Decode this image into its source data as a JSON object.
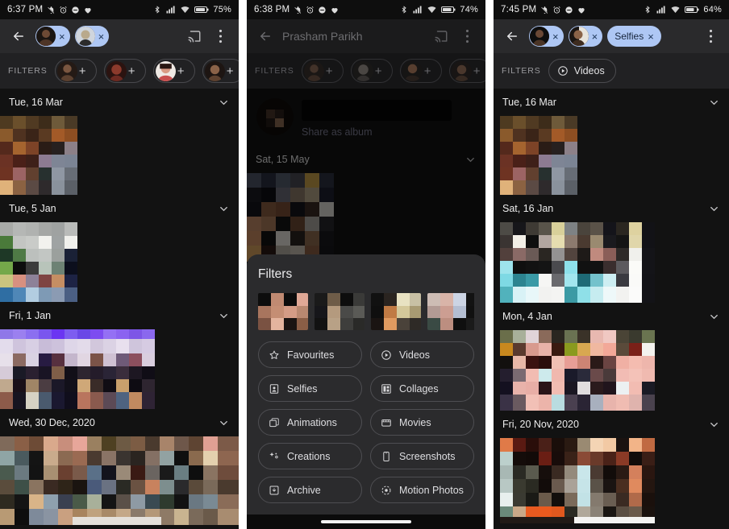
{
  "panels": [
    {
      "id": "panel-left",
      "status": {
        "time": "6:37 PM",
        "icons_left": [
          "silent-icon",
          "alarm-icon",
          "dnd-icon",
          "heart-icon"
        ],
        "icons_right": [
          "bluetooth-icon",
          "signal-icon",
          "wifi-icon",
          "battery-icon"
        ],
        "battery": "75%"
      },
      "appbar": {
        "back": "back-arrow-icon",
        "cast": "cast-icon",
        "overflow": "more-vertical-icon",
        "chips": [
          {
            "type": "person",
            "remove": "×"
          },
          {
            "type": "person",
            "remove": "×"
          }
        ]
      },
      "filters": {
        "label": "FILTERS",
        "face_chips": 5,
        "plus": "+"
      },
      "sections": [
        {
          "date": "Tue, 16 Mar",
          "chevron": "chevron-down-icon"
        },
        {
          "date": "Tue, 5 Jan",
          "chevron": "chevron-down-icon"
        },
        {
          "date": "Fri, 1 Jan",
          "chevron": "chevron-down-icon"
        },
        {
          "date": "Wed, 30 Dec, 2020",
          "chevron": "chevron-down-icon"
        }
      ]
    },
    {
      "id": "panel-middle",
      "status": {
        "time": "6:38 PM",
        "icons_left": [
          "silent-icon",
          "alarm-icon",
          "dnd-icon",
          "heart-icon"
        ],
        "icons_right": [
          "bluetooth-icon",
          "signal-icon",
          "wifi-icon",
          "battery-icon"
        ],
        "battery": "74%"
      },
      "appbar": {
        "back": "back-arrow-icon",
        "title": "Prasham Parikh",
        "cast": "cast-icon",
        "overflow": "more-vertical-icon"
      },
      "filters": {
        "label": "FILTERS",
        "face_chips": 5,
        "plus": "+"
      },
      "share": {
        "link": "Share as album"
      },
      "sections": [
        {
          "date": "Sat, 15 May",
          "chevron": "chevron-down-icon"
        }
      ],
      "sheet": {
        "title": "Filters",
        "thumbs": 5,
        "chips": [
          {
            "label": "Favourites",
            "icon": "star-icon"
          },
          {
            "label": "Videos",
            "icon": "play-circle-icon"
          },
          {
            "label": "Selfies",
            "icon": "portrait-icon"
          },
          {
            "label": "Collages",
            "icon": "collage-icon"
          },
          {
            "label": "Animations",
            "icon": "animation-icon"
          },
          {
            "label": "Movies",
            "icon": "movie-icon"
          },
          {
            "label": "Creations",
            "icon": "sparkle-icon"
          },
          {
            "label": "Screenshots",
            "icon": "phone-icon"
          },
          {
            "label": "Archive",
            "icon": "archive-icon"
          },
          {
            "label": "Motion Photos",
            "icon": "motion-icon"
          }
        ]
      },
      "navbar": "home-gesture-pill"
    },
    {
      "id": "panel-right",
      "status": {
        "time": "7:45 PM",
        "icons_left": [
          "silent-icon",
          "alarm-icon",
          "dnd-icon",
          "heart-icon"
        ],
        "icons_right": [
          "bluetooth-icon",
          "signal-icon",
          "wifi-icon",
          "battery-icon"
        ],
        "battery": "64%"
      },
      "appbar": {
        "back": "back-arrow-icon",
        "overflow": "more-vertical-icon",
        "chips": [
          {
            "type": "person",
            "remove": "×"
          },
          {
            "type": "person",
            "remove": "×"
          },
          {
            "type": "text",
            "label": "Selfies",
            "remove": "×"
          }
        ]
      },
      "filters": {
        "label": "FILTERS",
        "videos_chip": "Videos",
        "videos_icon": "play-circle-icon"
      },
      "sections": [
        {
          "date": "Tue, 16 Mar",
          "chevron": "chevron-down-icon"
        },
        {
          "date": "Sat, 16 Jan",
          "chevron": "chevron-down-icon"
        },
        {
          "date": "Mon, 4 Jan",
          "chevron": "chevron-down-icon"
        },
        {
          "date": "Fri, 20 Nov, 2020",
          "chevron": "chevron-down-icon"
        }
      ]
    }
  ],
  "colors": {
    "chip_blue": "#aec7f4",
    "chip_blue_text": "#17263d",
    "appbar": "#2a2a2c",
    "filter_strip": "#212123",
    "page_bg": "#121212",
    "sheet_bg": "#2b2b2d"
  }
}
